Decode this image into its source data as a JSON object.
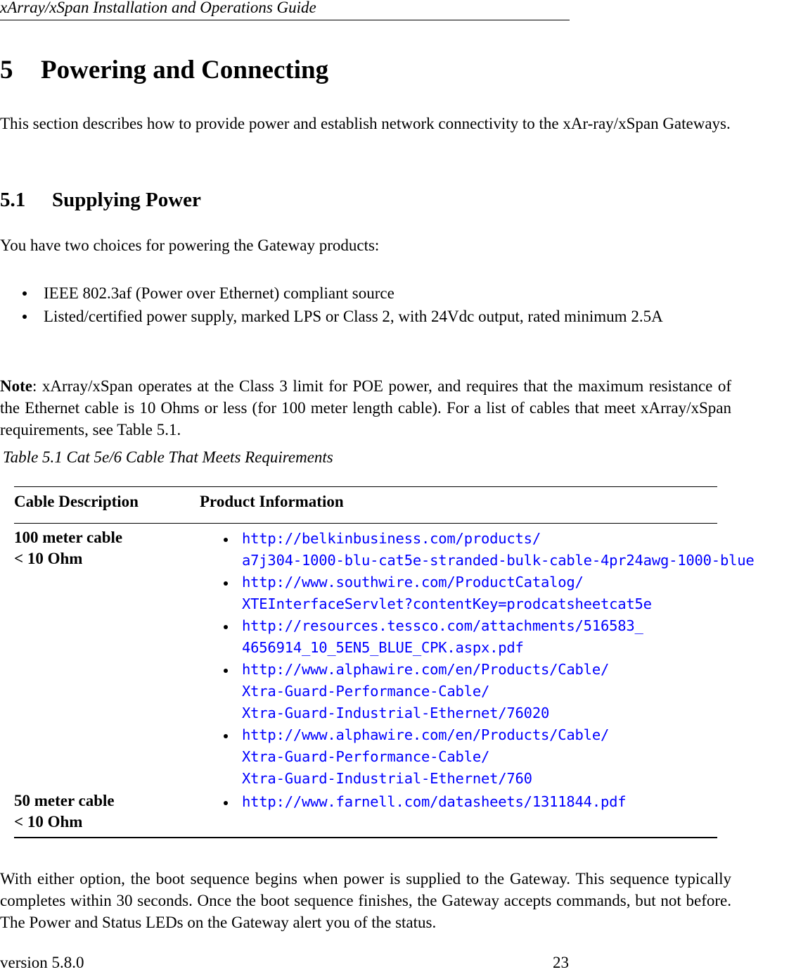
{
  "header": {
    "running_title": "xArray/xSpan Installation and Operations Guide"
  },
  "section": {
    "number": "5",
    "title": "Powering and Connecting",
    "intro": "This section describes how to provide power and establish network connectivity to the xAr-ray/xSpan Gateways."
  },
  "subsection": {
    "number": "5.1",
    "title": "Supplying Power",
    "lead": "You have two choices for powering the Gateway products:",
    "options": [
      "IEEE 802.3af (Power over Ethernet) compliant source",
      "Listed/certified power supply, marked LPS or Class 2, with 24Vdc output, rated minimum 2.5A"
    ],
    "note_label": "Note",
    "note_text": ": xArray/xSpan operates at the Class 3 limit for POE power, and requires that the maximum resistance of the Ethernet cable is 10 Ohms or less (for 100 meter length cable). For a list of cables that meet xArray/xSpan requirements, see Table 5.1.",
    "closing": "With either option, the boot sequence begins when power is supplied to the Gateway. This sequence typically completes within 30 seconds. Once the boot sequence finishes, the Gateway accepts commands, but not before. The Power and Status LEDs on the Gateway alert you of the status."
  },
  "table": {
    "caption": "Table 5.1 Cat 5e/6 Cable That Meets Requirements",
    "columns": [
      "Cable Description",
      "Product Information"
    ],
    "rows": [
      {
        "description": [
          "100 meter cable",
          "< 10 Ohm"
        ],
        "links": [
          [
            "http://belkinbusiness.com/products/",
            "a7j304-1000-blu-cat5e-stranded-bulk-cable-4pr24awg-1000-blue"
          ],
          [
            "http://www.southwire.com/ProductCatalog/",
            "XTEInterfaceServlet?contentKey=prodcatsheetcat5e"
          ],
          [
            "http://resources.tessco.com/attachments/516583_",
            "4656914_10_5EN5_BLUE_CPK.aspx.pdf"
          ],
          [
            "http://www.alphawire.com/en/Products/Cable/",
            "Xtra-Guard-Performance-Cable/",
            "Xtra-Guard-Industrial-Ethernet/76020"
          ],
          [
            "http://www.alphawire.com/en/Products/Cable/",
            "Xtra-Guard-Performance-Cable/",
            "Xtra-Guard-Industrial-Ethernet/760"
          ]
        ]
      },
      {
        "description": [
          "50 meter cable",
          "< 10 Ohm"
        ],
        "links": [
          [
            "http://www.farnell.com/datasheets/1311844.pdf"
          ]
        ]
      }
    ],
    "link_color": "#0000ff"
  },
  "footer": {
    "version": "version 5.8.0",
    "page_number": "23"
  }
}
